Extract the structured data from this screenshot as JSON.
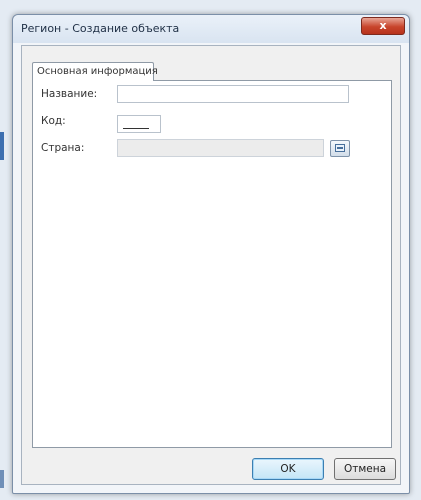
{
  "window": {
    "title": "Регион - Создание объекта",
    "close_glyph": "x"
  },
  "tabs": [
    {
      "label": "Основная информация",
      "active": true
    }
  ],
  "form": {
    "name": {
      "label": "Название:",
      "value": ""
    },
    "code": {
      "label": "Код:",
      "value": ""
    },
    "country": {
      "label": "Страна:",
      "value": ""
    }
  },
  "buttons": {
    "ok": "OK",
    "cancel": "Отмена"
  },
  "colors": {
    "close_button": "#c8452c",
    "default_button_border": "#3c7fb1"
  },
  "icons": {
    "close": "close-icon",
    "lookup": "lookup-icon"
  }
}
